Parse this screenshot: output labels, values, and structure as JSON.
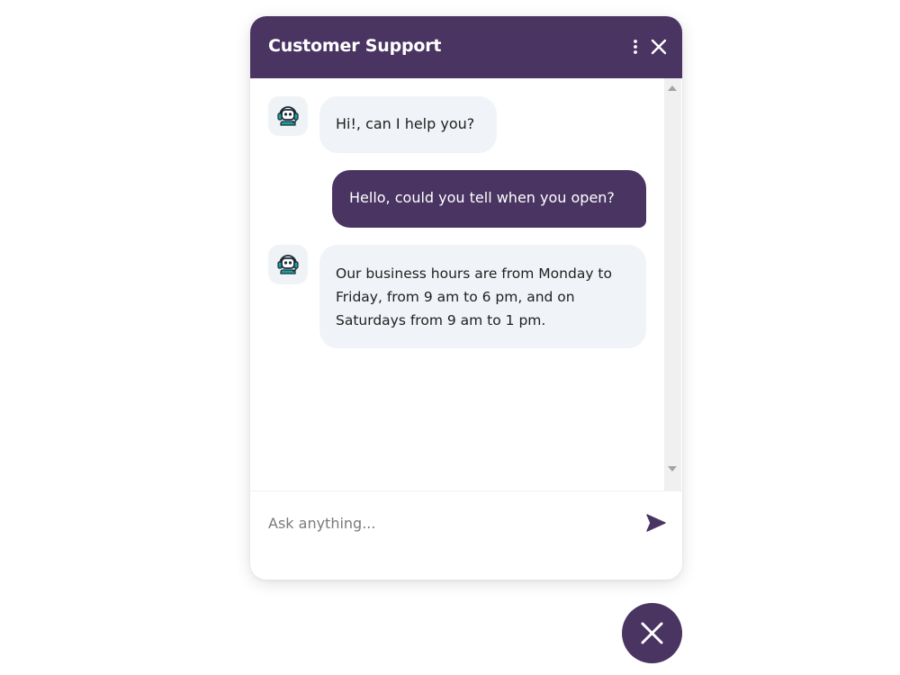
{
  "header": {
    "title": "Customer Support",
    "menu_icon": "more-vertical-icon",
    "close_icon": "close-icon"
  },
  "messages": [
    {
      "sender": "bot",
      "text": "Hi!, can I help you?"
    },
    {
      "sender": "user",
      "text": "Hello, could you tell when you open?"
    },
    {
      "sender": "bot",
      "text": "Our business hours are from Monday to Friday, from 9 am to 6 pm, and on Saturdays from 9 am to 1 pm."
    }
  ],
  "input": {
    "placeholder": "Ask anything...",
    "value": "",
    "send_icon": "send-icon"
  },
  "launcher": {
    "icon": "close-icon"
  },
  "colors": {
    "accent": "#4a3462",
    "bot_bubble": "#f0f3f7",
    "bot_avatar_bg": "#f0f3f6",
    "bot_icon_teal": "#1aa0a0"
  }
}
